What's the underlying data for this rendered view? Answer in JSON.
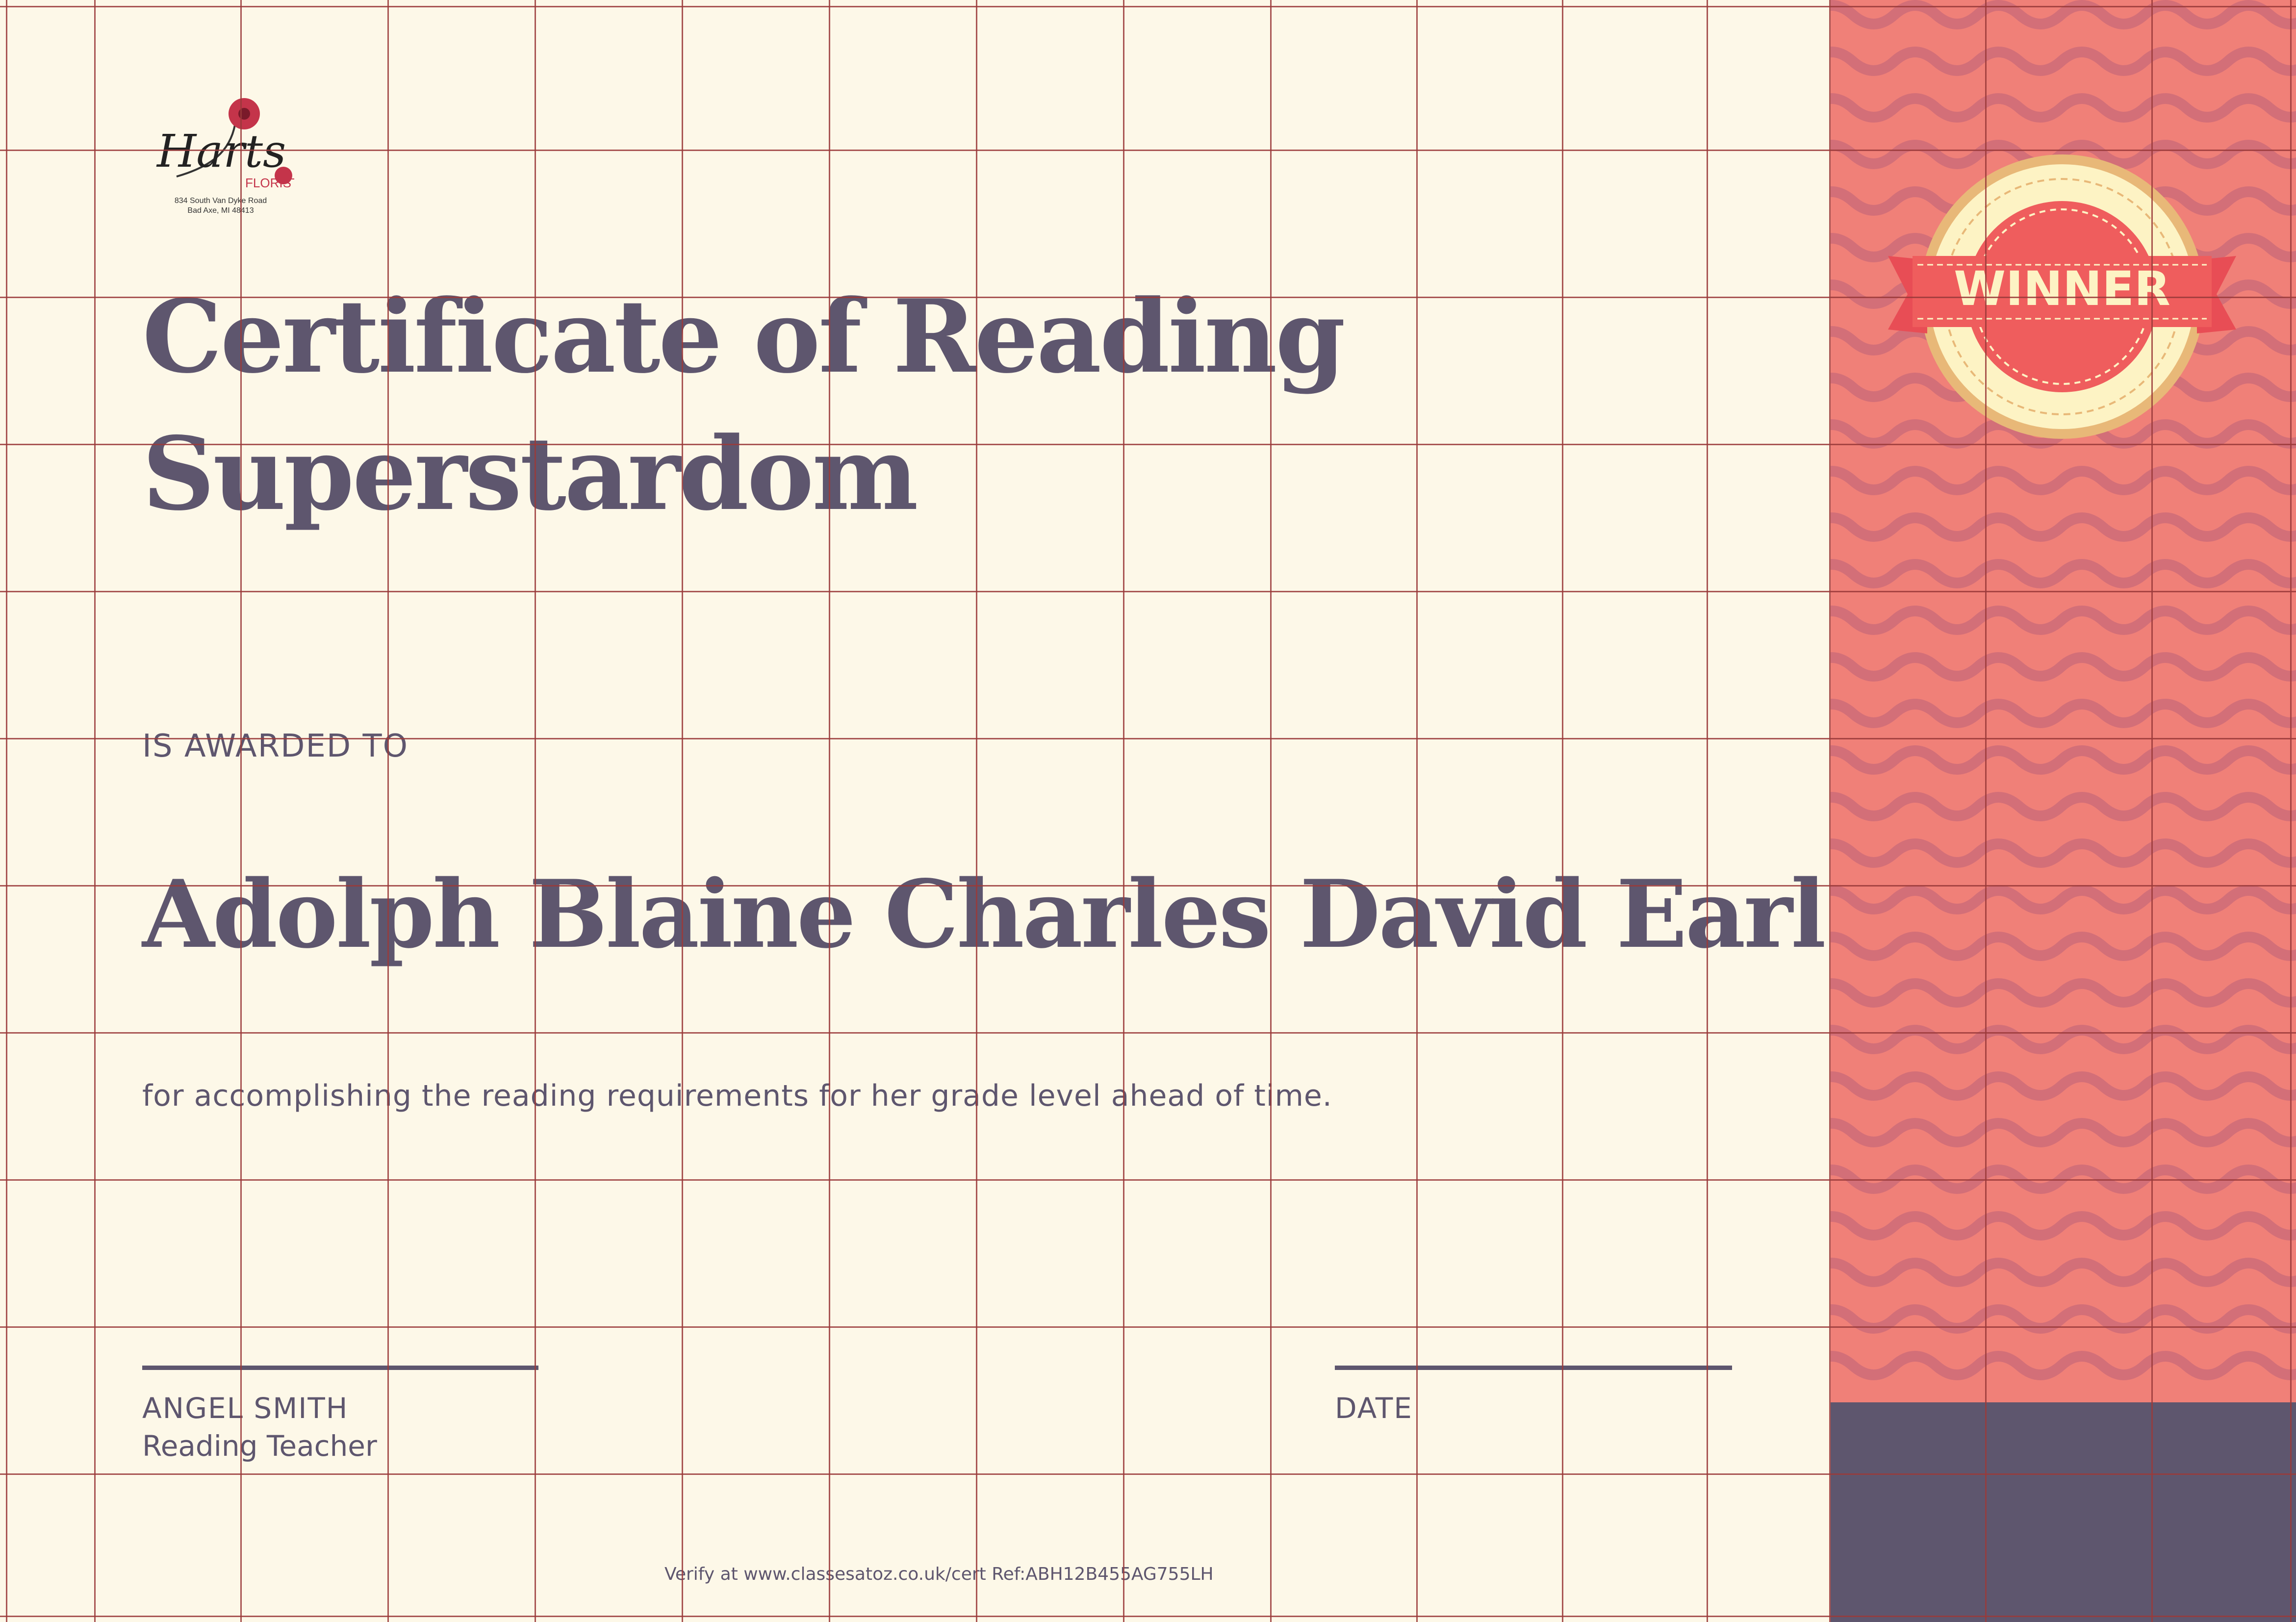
{
  "certificate": {
    "title_line1": "Certificate of Reading",
    "title_line2": "Superstardom",
    "awarded_label": "IS AWARDED TO",
    "recipient": "Adolph Blaine Charles David Earl",
    "reason": "for accomplishing the reading requirements for her grade level ahead of time.",
    "signature": {
      "name": "ANGEL SMITH",
      "role": "Reading Teacher"
    },
    "date_label": "DATE",
    "verify_text": "Verify at www.classesatoz.co.uk/cert Ref:ABH12B455AG755LH"
  },
  "logo": {
    "brand": "Harts",
    "tagline": "FLORIST",
    "address_line1": "834 South Van Dyke Road",
    "address_line2": "Bad Axe, MI 48413"
  },
  "badge": {
    "label": "WINNER"
  },
  "colors": {
    "background": "#fdf8e8",
    "text": "#5e566e",
    "ribbon": "#f08078",
    "ribbon_wave": "#c96a78",
    "ribbon_bottom": "#5e566e",
    "grid": "#9a3a3a",
    "badge_outer": "#e8b878",
    "badge_inner": "#fdf3c4",
    "badge_center": "#ef5d5d"
  }
}
